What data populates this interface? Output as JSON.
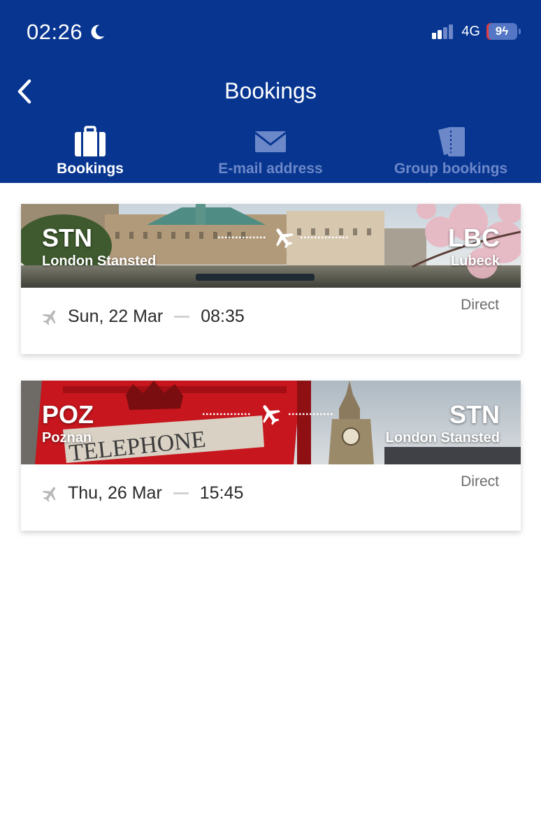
{
  "status_bar": {
    "time": "02:26",
    "network": "4G",
    "battery": "9"
  },
  "header": {
    "title": "Bookings"
  },
  "tabs": [
    {
      "label": "Bookings",
      "icon": "briefcase-icon",
      "active": true
    },
    {
      "label": "E-mail address",
      "icon": "envelope-icon",
      "active": false
    },
    {
      "label": "Group bookings",
      "icon": "tickets-icon",
      "active": false
    }
  ],
  "bookings": [
    {
      "origin_code": "STN",
      "origin_city": "London Stansted",
      "destination_code": "LBC",
      "destination_city": "Lubeck",
      "date": "Sun, 22 Mar",
      "time": "08:35",
      "type": "Direct"
    },
    {
      "origin_code": "POZ",
      "origin_city": "Poznan",
      "destination_code": "STN",
      "destination_city": "London Stansted",
      "date": "Thu, 26 Mar",
      "time": "15:45",
      "type": "Direct"
    }
  ],
  "colors": {
    "brand_blue": "#073590",
    "inactive_tab": "#6d88c9"
  }
}
